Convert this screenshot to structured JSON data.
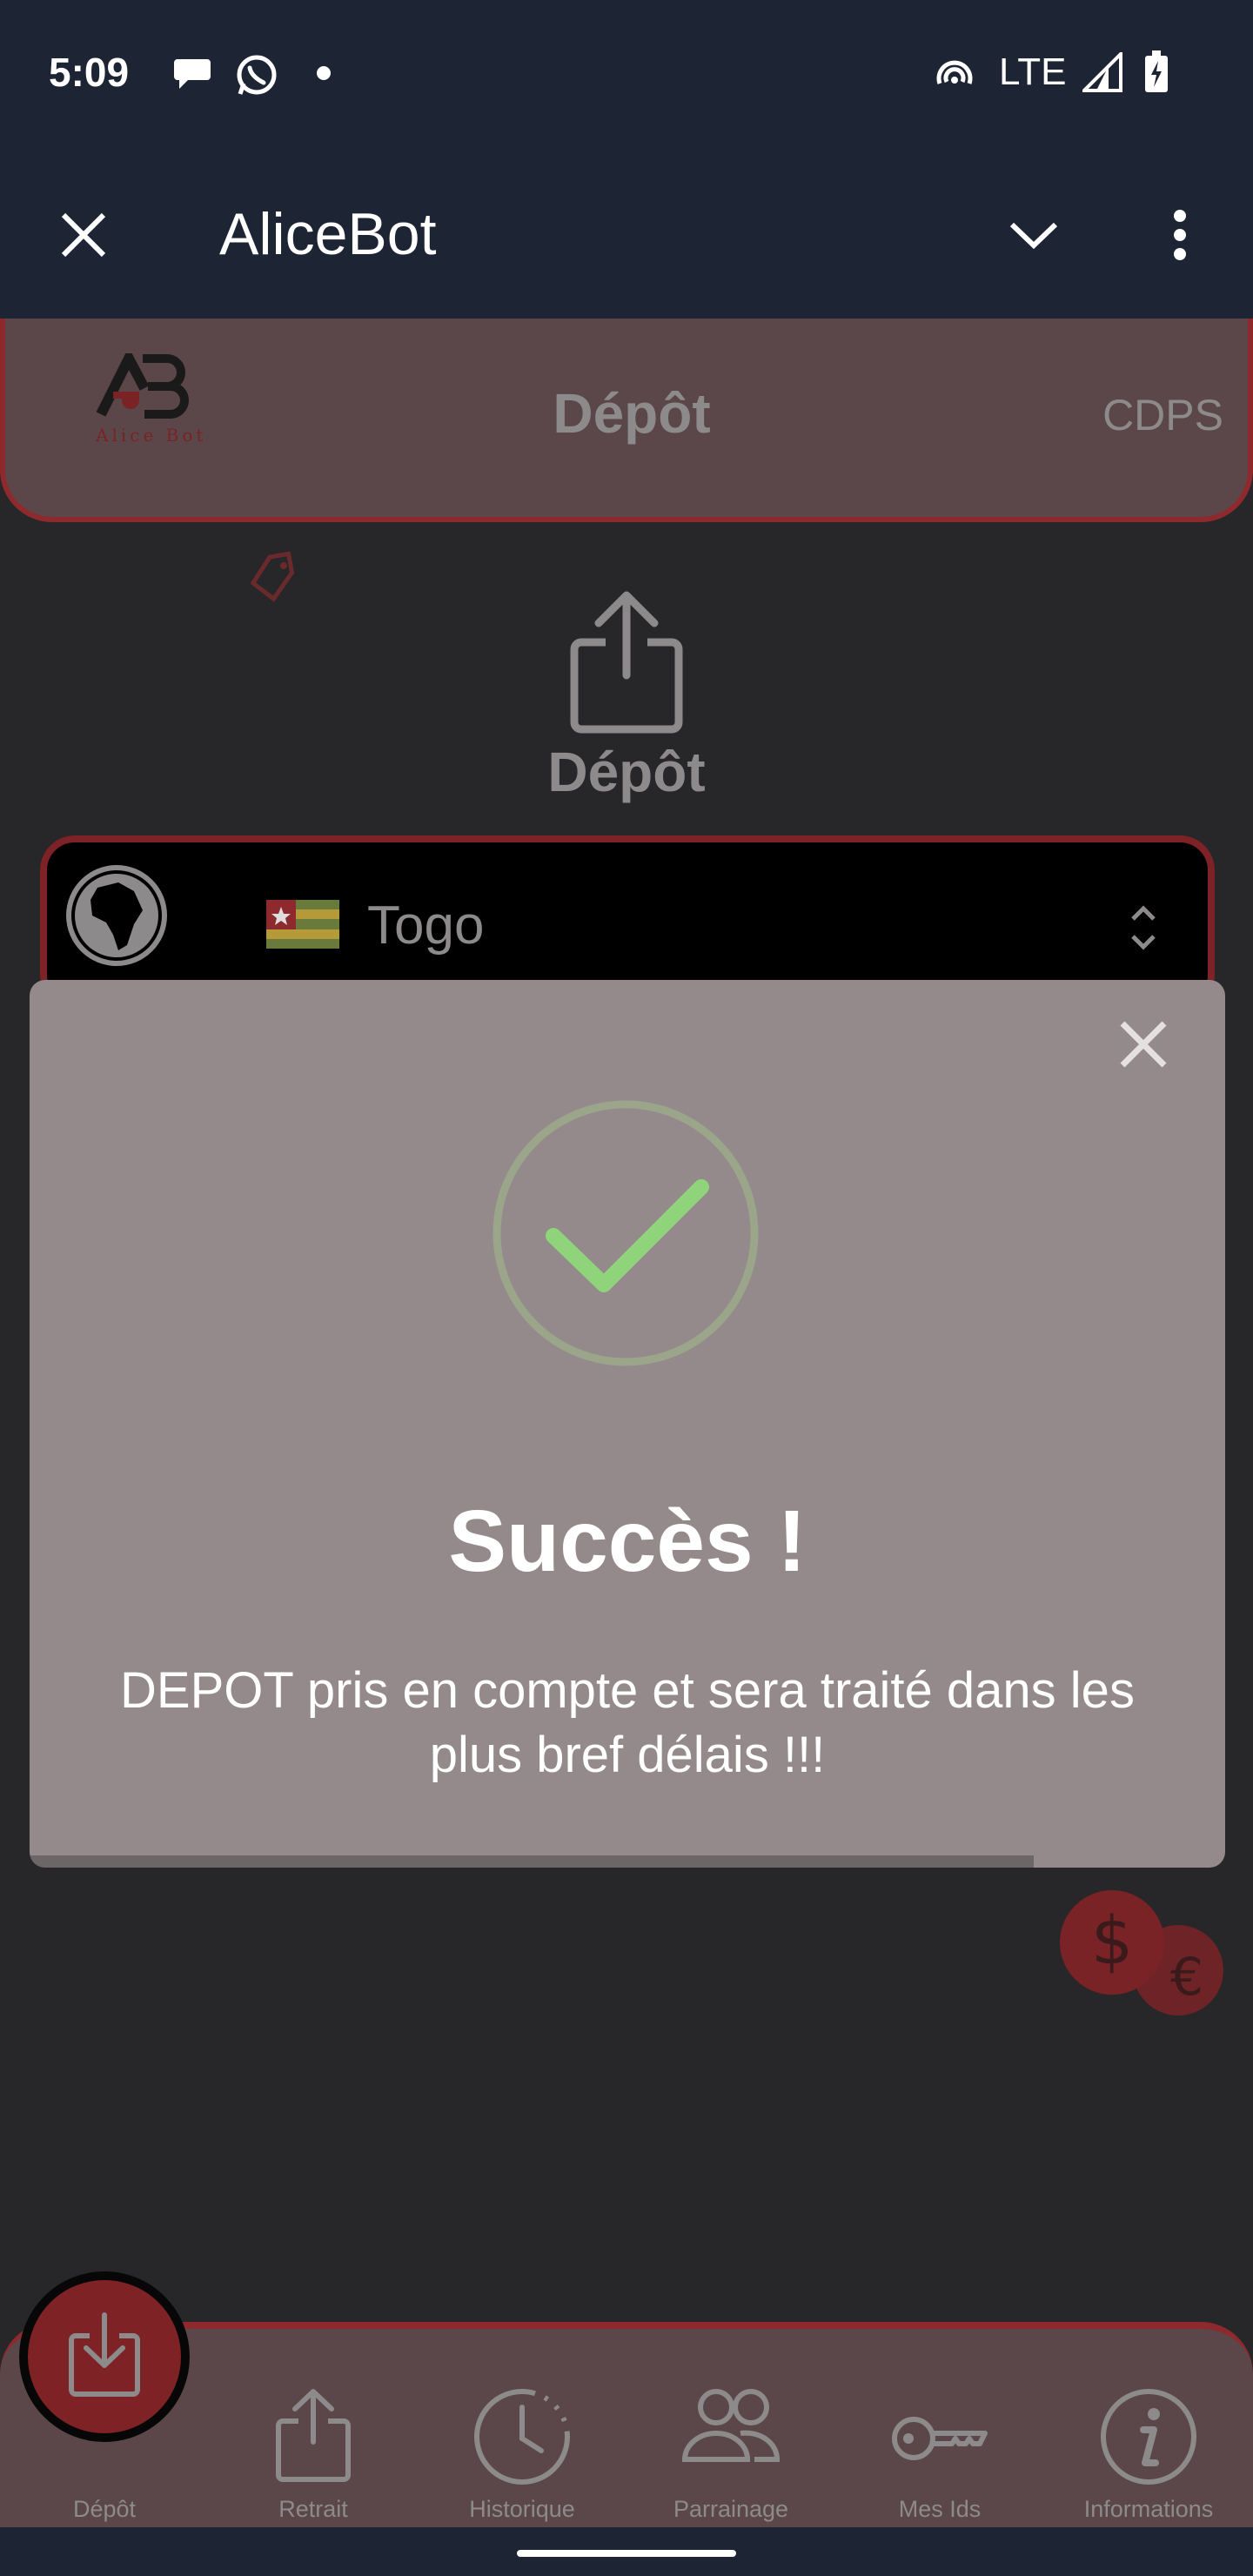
{
  "status_bar": {
    "time": "5:09",
    "network": "LTE",
    "notification_icons": [
      "chat-bubble-icon",
      "whatsapp-icon",
      "dot-icon"
    ],
    "system_icons": [
      "hotspot-icon",
      "signal-icon",
      "battery-charging-icon"
    ]
  },
  "app_bar": {
    "title": "AliceBot",
    "close_icon": "close-icon",
    "collapse_icon": "chevron-down-icon",
    "menu_icon": "more-vert-icon"
  },
  "header": {
    "logo_text": "Alice Bot",
    "title": "Dépôt",
    "right_label": "CDPS"
  },
  "main": {
    "section_title": "Dépôt",
    "section_icon": "upload-icon",
    "country_select": {
      "value": "Togo",
      "icon": "globe-icon",
      "flag": "togo-flag-icon"
    }
  },
  "modal": {
    "title": "Succès !",
    "message": "DEPOT pris en compte et sera traité dans les plus bref délais !!!",
    "progress": 0.84
  },
  "bottom_nav": {
    "items": [
      {
        "label": "Dépôt",
        "icon": "download-icon"
      },
      {
        "label": "Retrait",
        "icon": "upload-icon"
      },
      {
        "label": "Historique",
        "icon": "clock-icon"
      },
      {
        "label": "Parrainage",
        "icon": "people-icon"
      },
      {
        "label": "Mes Ids",
        "icon": "key-icon"
      },
      {
        "label": "Informations",
        "icon": "info-icon"
      }
    ]
  },
  "colors": {
    "status_bar": "#1d2535",
    "accent_red": "#8e2a2d",
    "panel": "#5b4749",
    "modal": "#948a8b",
    "success_green": "#8fd47a"
  }
}
